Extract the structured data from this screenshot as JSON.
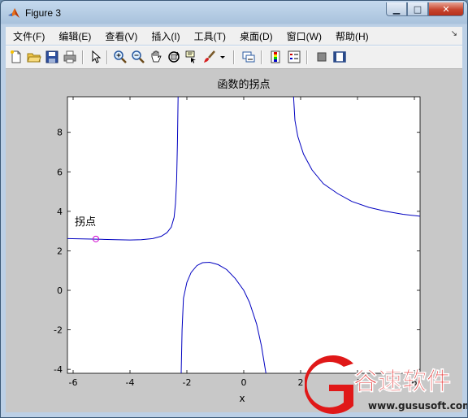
{
  "window": {
    "title": "Figure 3",
    "minimize_label": "▁",
    "maximize_label": "□",
    "close_label": "✕"
  },
  "menu": {
    "items": [
      "文件(F)",
      "编辑(E)",
      "查看(V)",
      "插入(I)",
      "工具(T)",
      "桌面(D)",
      "窗口(W)",
      "帮助(H)"
    ],
    "overflow_icon": "chevron-double-icon"
  },
  "toolbar": {
    "buttons": [
      "new-figure-icon",
      "open-file-icon",
      "save-icon",
      "print-icon",
      "edit-plot-arrow-icon",
      "zoom-in-icon",
      "zoom-out-icon",
      "pan-hand-icon",
      "rotate-3d-icon",
      "data-cursor-icon",
      "brush-icon",
      "link-plot-icon",
      "colorbar-icon",
      "legend-icon",
      "hide-plot-tools-icon",
      "show-plot-tools-icon"
    ]
  },
  "chart_data": {
    "type": "line",
    "title": "函数的拐点",
    "xlabel": "x",
    "ylabel": "",
    "xlim": [
      -6.2,
      6.2
    ],
    "ylim": [
      -4.2,
      9.8
    ],
    "xticks": [
      -6,
      -4,
      -2,
      0,
      2,
      4,
      6
    ],
    "yticks": [
      -4,
      -2,
      0,
      2,
      4,
      6,
      8
    ],
    "grid": false,
    "series": [
      {
        "color": "#0000c0",
        "segments": [
          [
            [
              -6.2,
              2.62
            ],
            [
              -5.5,
              2.6
            ],
            [
              -5.0,
              2.58
            ],
            [
              -4.5,
              2.56
            ],
            [
              -4.0,
              2.55
            ],
            [
              -3.6,
              2.56
            ],
            [
              -3.2,
              2.62
            ],
            [
              -2.9,
              2.74
            ],
            [
              -2.7,
              2.92
            ],
            [
              -2.55,
              3.2
            ],
            [
              -2.45,
              3.7
            ],
            [
              -2.4,
              4.4
            ],
            [
              -2.36,
              5.6
            ],
            [
              -2.33,
              7.5
            ],
            [
              -2.31,
              9.8
            ]
          ],
          [
            [
              -2.2,
              -4.2
            ],
            [
              -2.17,
              -2.0
            ],
            [
              -2.12,
              -0.4
            ],
            [
              -2.0,
              0.4
            ],
            [
              -1.85,
              0.9
            ],
            [
              -1.65,
              1.25
            ],
            [
              -1.45,
              1.4
            ],
            [
              -1.2,
              1.42
            ],
            [
              -0.9,
              1.3
            ],
            [
              -0.6,
              1.05
            ],
            [
              -0.3,
              0.6
            ],
            [
              0.0,
              0.0
            ],
            [
              0.2,
              -0.6
            ],
            [
              0.45,
              -1.7
            ],
            [
              0.62,
              -2.8
            ],
            [
              0.78,
              -4.2
            ]
          ],
          [
            [
              1.75,
              9.8
            ],
            [
              1.8,
              8.6
            ],
            [
              1.9,
              7.8
            ],
            [
              2.1,
              6.9
            ],
            [
              2.4,
              6.1
            ],
            [
              2.8,
              5.4
            ],
            [
              3.3,
              4.9
            ],
            [
              3.8,
              4.5
            ],
            [
              4.4,
              4.2
            ],
            [
              5.0,
              4.0
            ],
            [
              5.6,
              3.85
            ],
            [
              6.2,
              3.75
            ]
          ]
        ]
      }
    ],
    "annotations": [
      {
        "text": "拐点",
        "x": -5.2,
        "y": 2.6,
        "marker": "circle",
        "marker_color": "#d000d0"
      }
    ]
  },
  "watermark": {
    "brand": "谷速软件",
    "url": "www.gususoft.com",
    "logo_color": "#e01818"
  }
}
